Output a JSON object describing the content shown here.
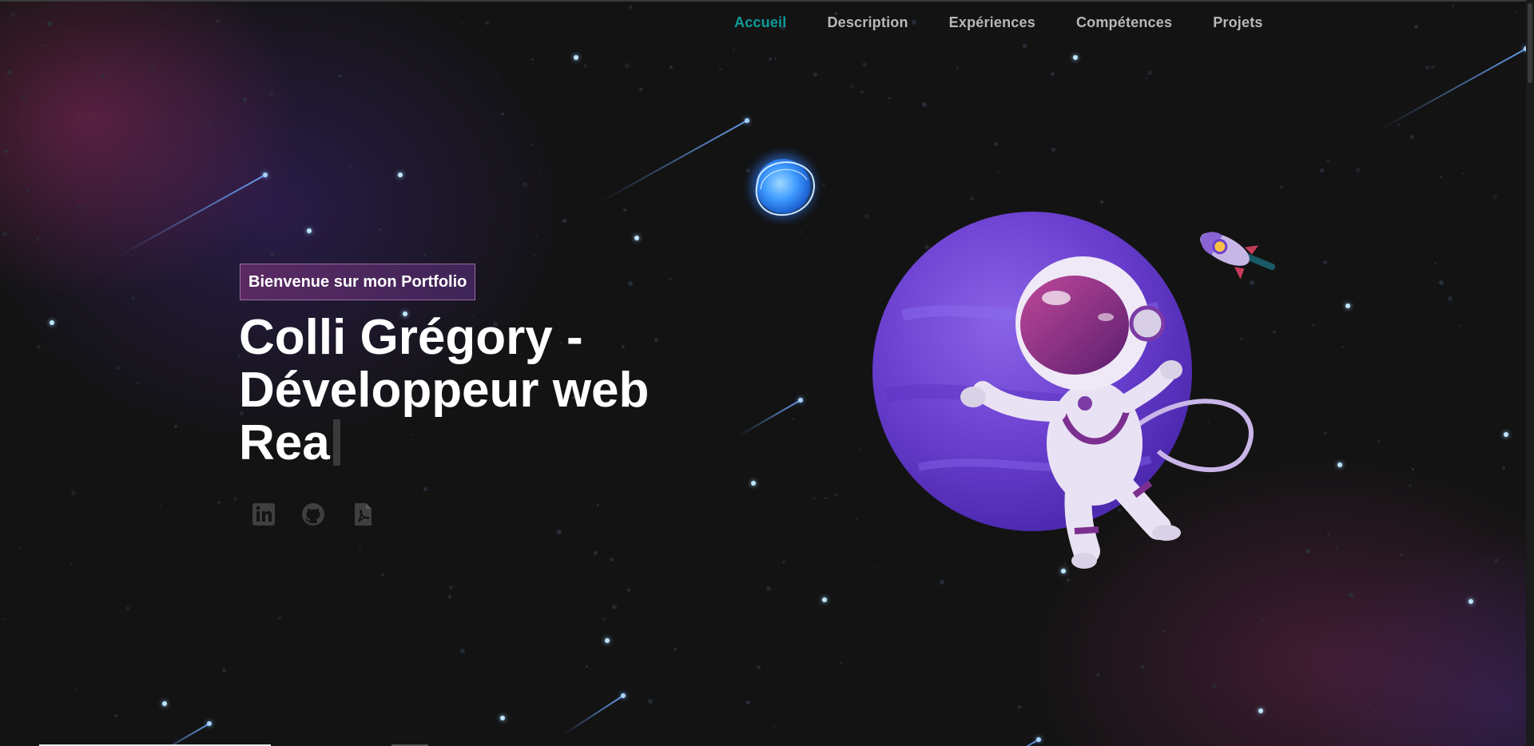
{
  "nav": {
    "items": [
      {
        "label": "Accueil",
        "active": true
      },
      {
        "label": "Description",
        "active": false
      },
      {
        "label": "Expériences",
        "active": false
      },
      {
        "label": "Compétences",
        "active": false
      },
      {
        "label": "Projets",
        "active": false
      }
    ]
  },
  "hero": {
    "badge": "Bienvenue sur mon Portfolio",
    "title_lines": [
      "Colli Grégory -",
      "Développeur web",
      "Rea"
    ]
  },
  "socials": [
    {
      "icon": "linkedin-icon"
    },
    {
      "icon": "github-icon"
    },
    {
      "icon": "pdf-icon"
    }
  ],
  "colors": {
    "accent": "#0e9b9b",
    "background": "#131313",
    "badge_bg": "#4d2860",
    "text": "#ffffff",
    "nav_text": "#b8b8b8"
  }
}
